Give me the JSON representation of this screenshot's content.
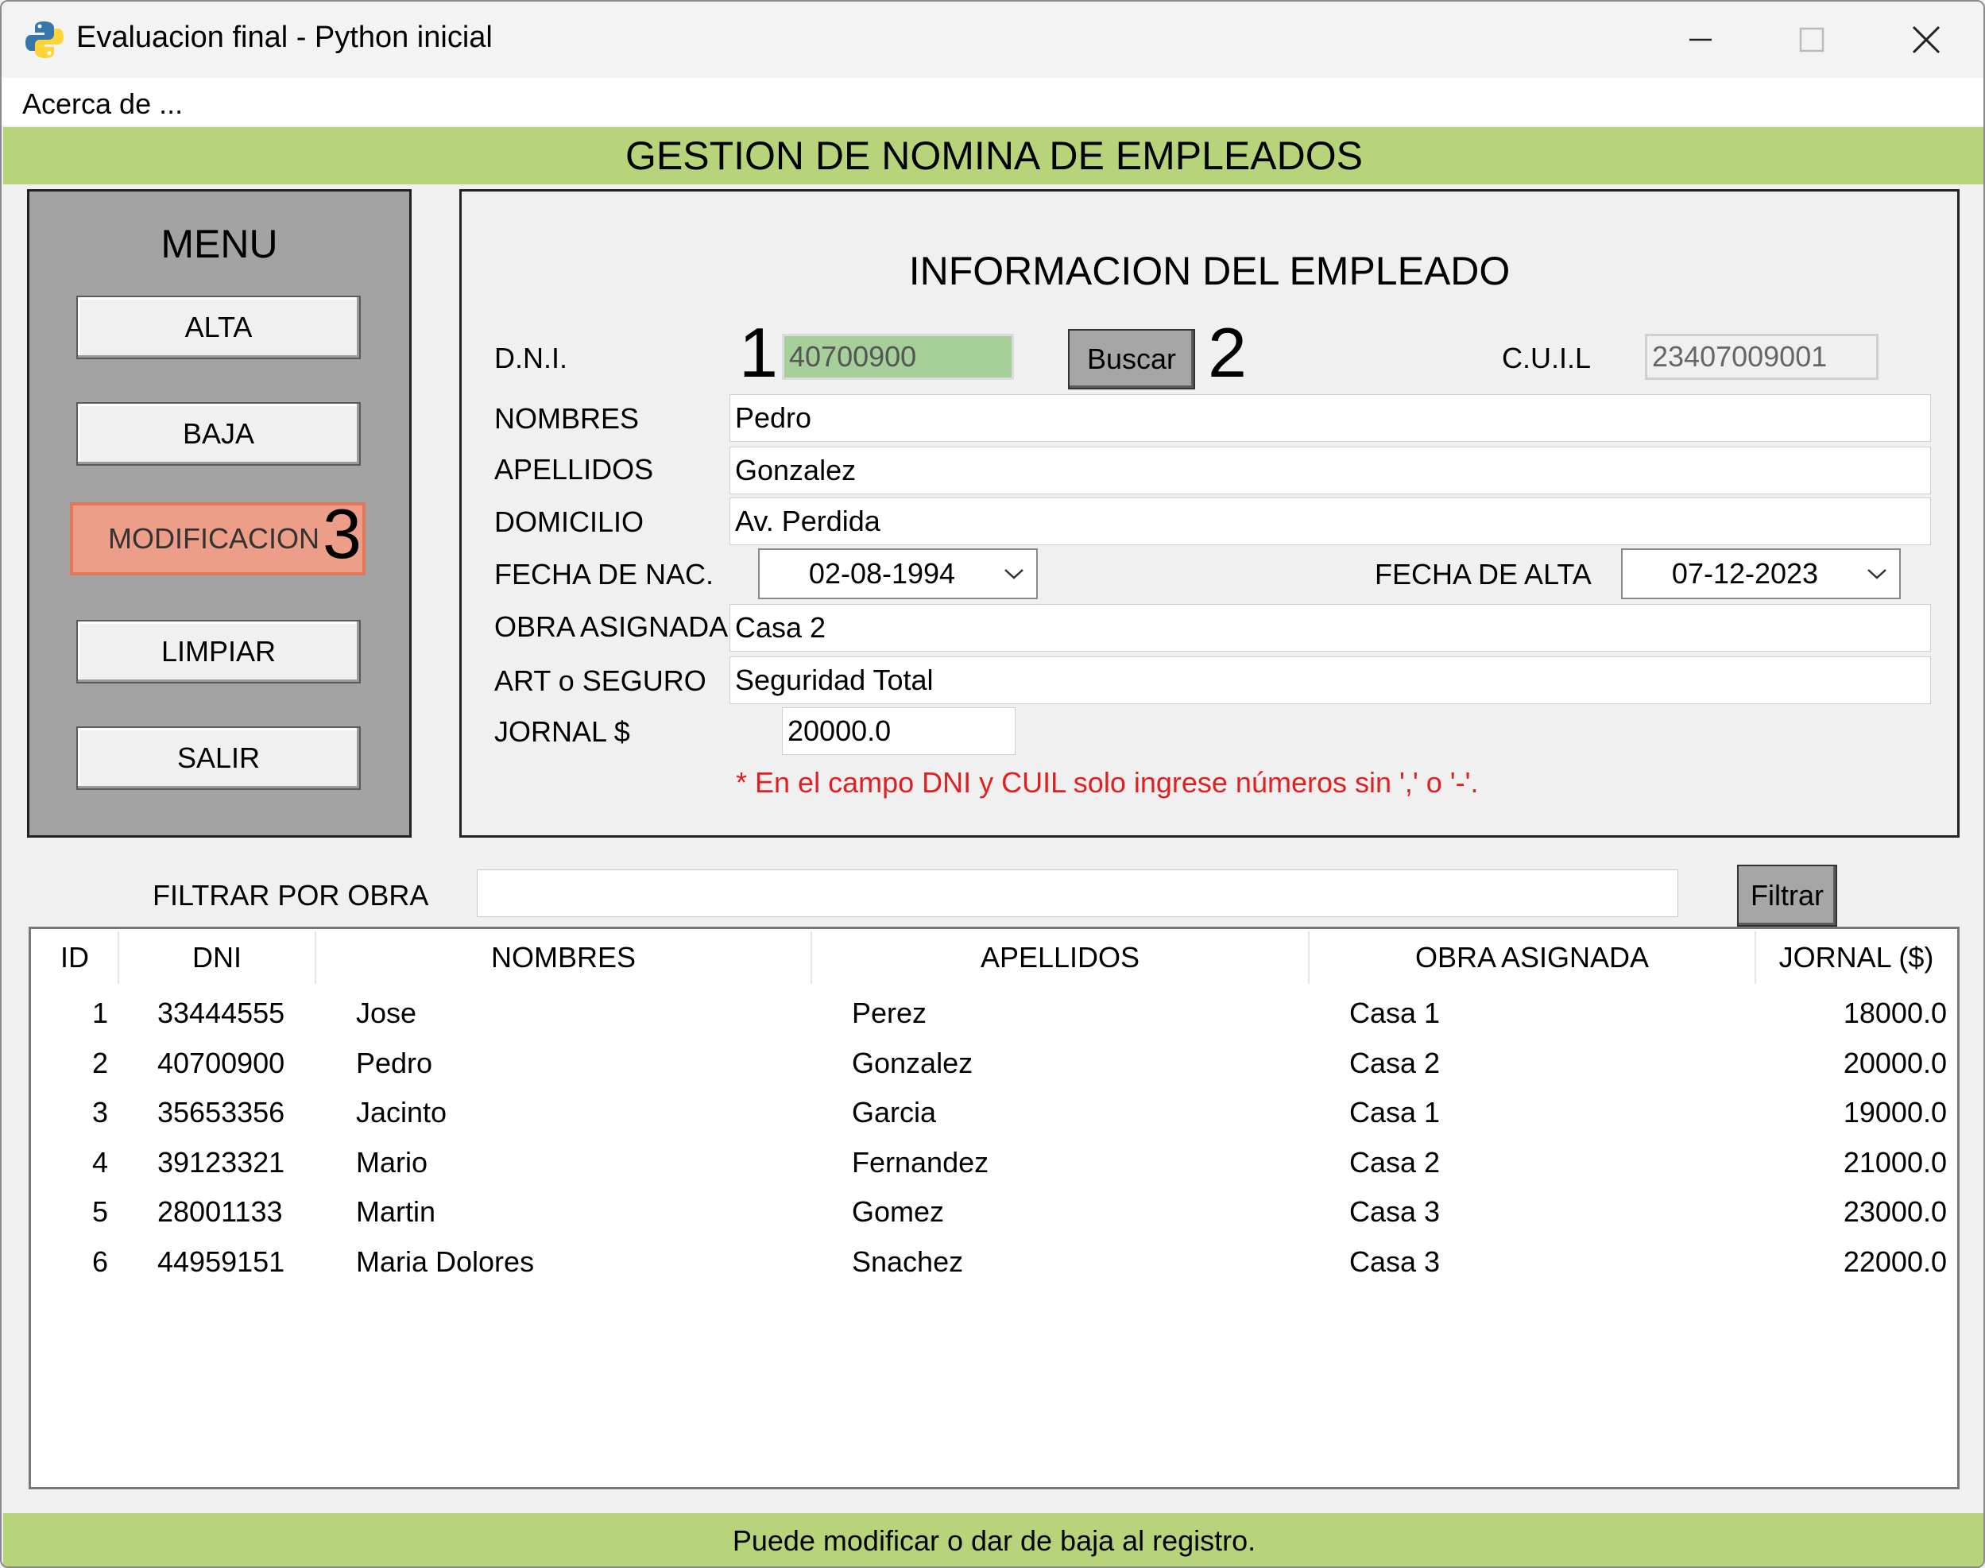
{
  "window": {
    "title": "Evaluacion final - Python inicial"
  },
  "menubar": {
    "acerca": "Acerca de ..."
  },
  "header": {
    "title": "GESTION DE NOMINA DE EMPLEADOS"
  },
  "menu": {
    "title": "MENU",
    "buttons": [
      "ALTA",
      "BAJA",
      "MODIFICACION",
      "LIMPIAR",
      "SALIR"
    ],
    "active": "MODIFICACION",
    "active_color": "#ec9e88"
  },
  "info": {
    "title": "INFORMACION DEL EMPLEADO",
    "labels": {
      "dni": "D.N.I.",
      "cuil": "C.U.I.L",
      "nombres": "NOMBRES",
      "apellidos": "APELLIDOS",
      "domicilio": "DOMICILIO",
      "fecha_nac": "FECHA DE NAC.",
      "fecha_alta": "FECHA DE ALTA",
      "obra": "OBRA ASIGNADA",
      "art": "ART o SEGURO",
      "jornal": "JORNAL $"
    },
    "values": {
      "dni": "40700900",
      "cuil": "23407009001",
      "nombres": "Pedro",
      "apellidos": "Gonzalez",
      "domicilio": "Av. Perdida",
      "fecha_nac": "02-08-1994",
      "fecha_alta": "07-12-2023",
      "obra": "Casa 2",
      "art": "Seguridad Total",
      "jornal": "20000.0"
    },
    "buscar": "Buscar",
    "warning": "* En el campo DNI y CUIL solo ingrese números sin ',' o '-'."
  },
  "annotations": [
    "1",
    "2",
    "3"
  ],
  "filter": {
    "label": "FILTRAR POR OBRA",
    "value": "",
    "button": "Filtrar"
  },
  "table": {
    "headers": [
      "ID",
      "DNI",
      "NOMBRES",
      "APELLIDOS",
      "OBRA ASIGNADA",
      "JORNAL ($)"
    ],
    "rows": [
      [
        "1",
        "33444555",
        "Jose",
        "Perez",
        "Casa 1",
        "18000.0"
      ],
      [
        "2",
        "40700900",
        "Pedro",
        "Gonzalez",
        "Casa 2",
        "20000.0"
      ],
      [
        "3",
        "35653356",
        "Jacinto",
        "Garcia",
        "Casa 1",
        "19000.0"
      ],
      [
        "4",
        "39123321",
        "Mario",
        "Fernandez",
        "Casa 2",
        "21000.0"
      ],
      [
        "5",
        "28001133",
        "Martin",
        "Gomez",
        "Casa 3",
        "23000.0"
      ],
      [
        "6",
        "44959151",
        "Maria Dolores",
        "Snachez",
        "Casa 3",
        "22000.0"
      ]
    ]
  },
  "status": {
    "text": "Puede modificar o dar de baja al registro."
  },
  "colors": {
    "banner": "#b8d47a",
    "menu_panel": "#a3a3a3",
    "dni_field": "#a6cf9a",
    "warning": "#e02020"
  },
  "icons": {
    "app": "python-icon",
    "minimize": "minimize-icon",
    "maximize": "maximize-icon",
    "close": "close-icon",
    "dropdown": "chevron-down-icon"
  }
}
